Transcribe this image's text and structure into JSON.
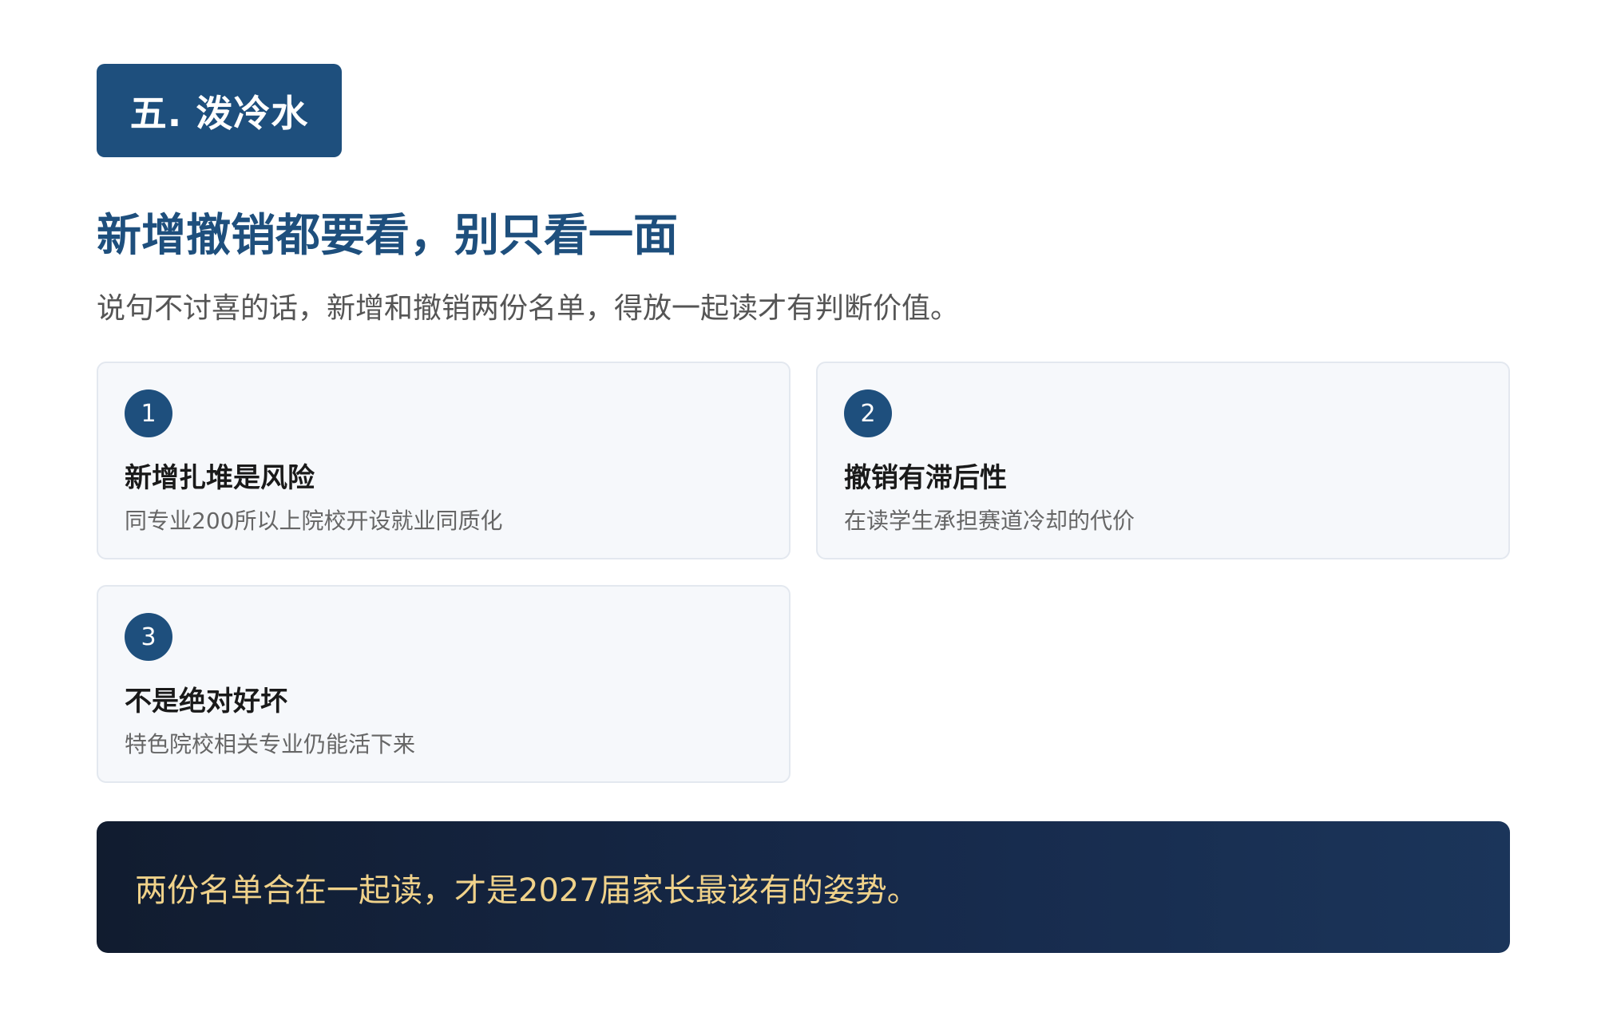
{
  "section": {
    "tag": "五. 泼冷水",
    "headline": "新增撤销都要看，别只看一面",
    "subtitle": "说句不讨喜的话，新增和撤销两份名单，得放一起读才有判断价值。"
  },
  "cards": [
    {
      "number": "1",
      "title": "新增扎堆是风险",
      "description": "同专业200所以上院校开设就业同质化"
    },
    {
      "number": "2",
      "title": "撤销有滞后性",
      "description": "在读学生承担赛道冷却的代价"
    },
    {
      "number": "3",
      "title": "不是绝对好坏",
      "description": "特色院校相关专业仍能活下来"
    }
  ],
  "banner": {
    "text": "两份名单合在一起读，才是2027届家长最该有的姿势。"
  },
  "colors": {
    "primary": "#1e4f7d",
    "card_bg": "#f6f8fb",
    "banner_text": "#f0d28a",
    "banner_bg": "#111c2f"
  }
}
